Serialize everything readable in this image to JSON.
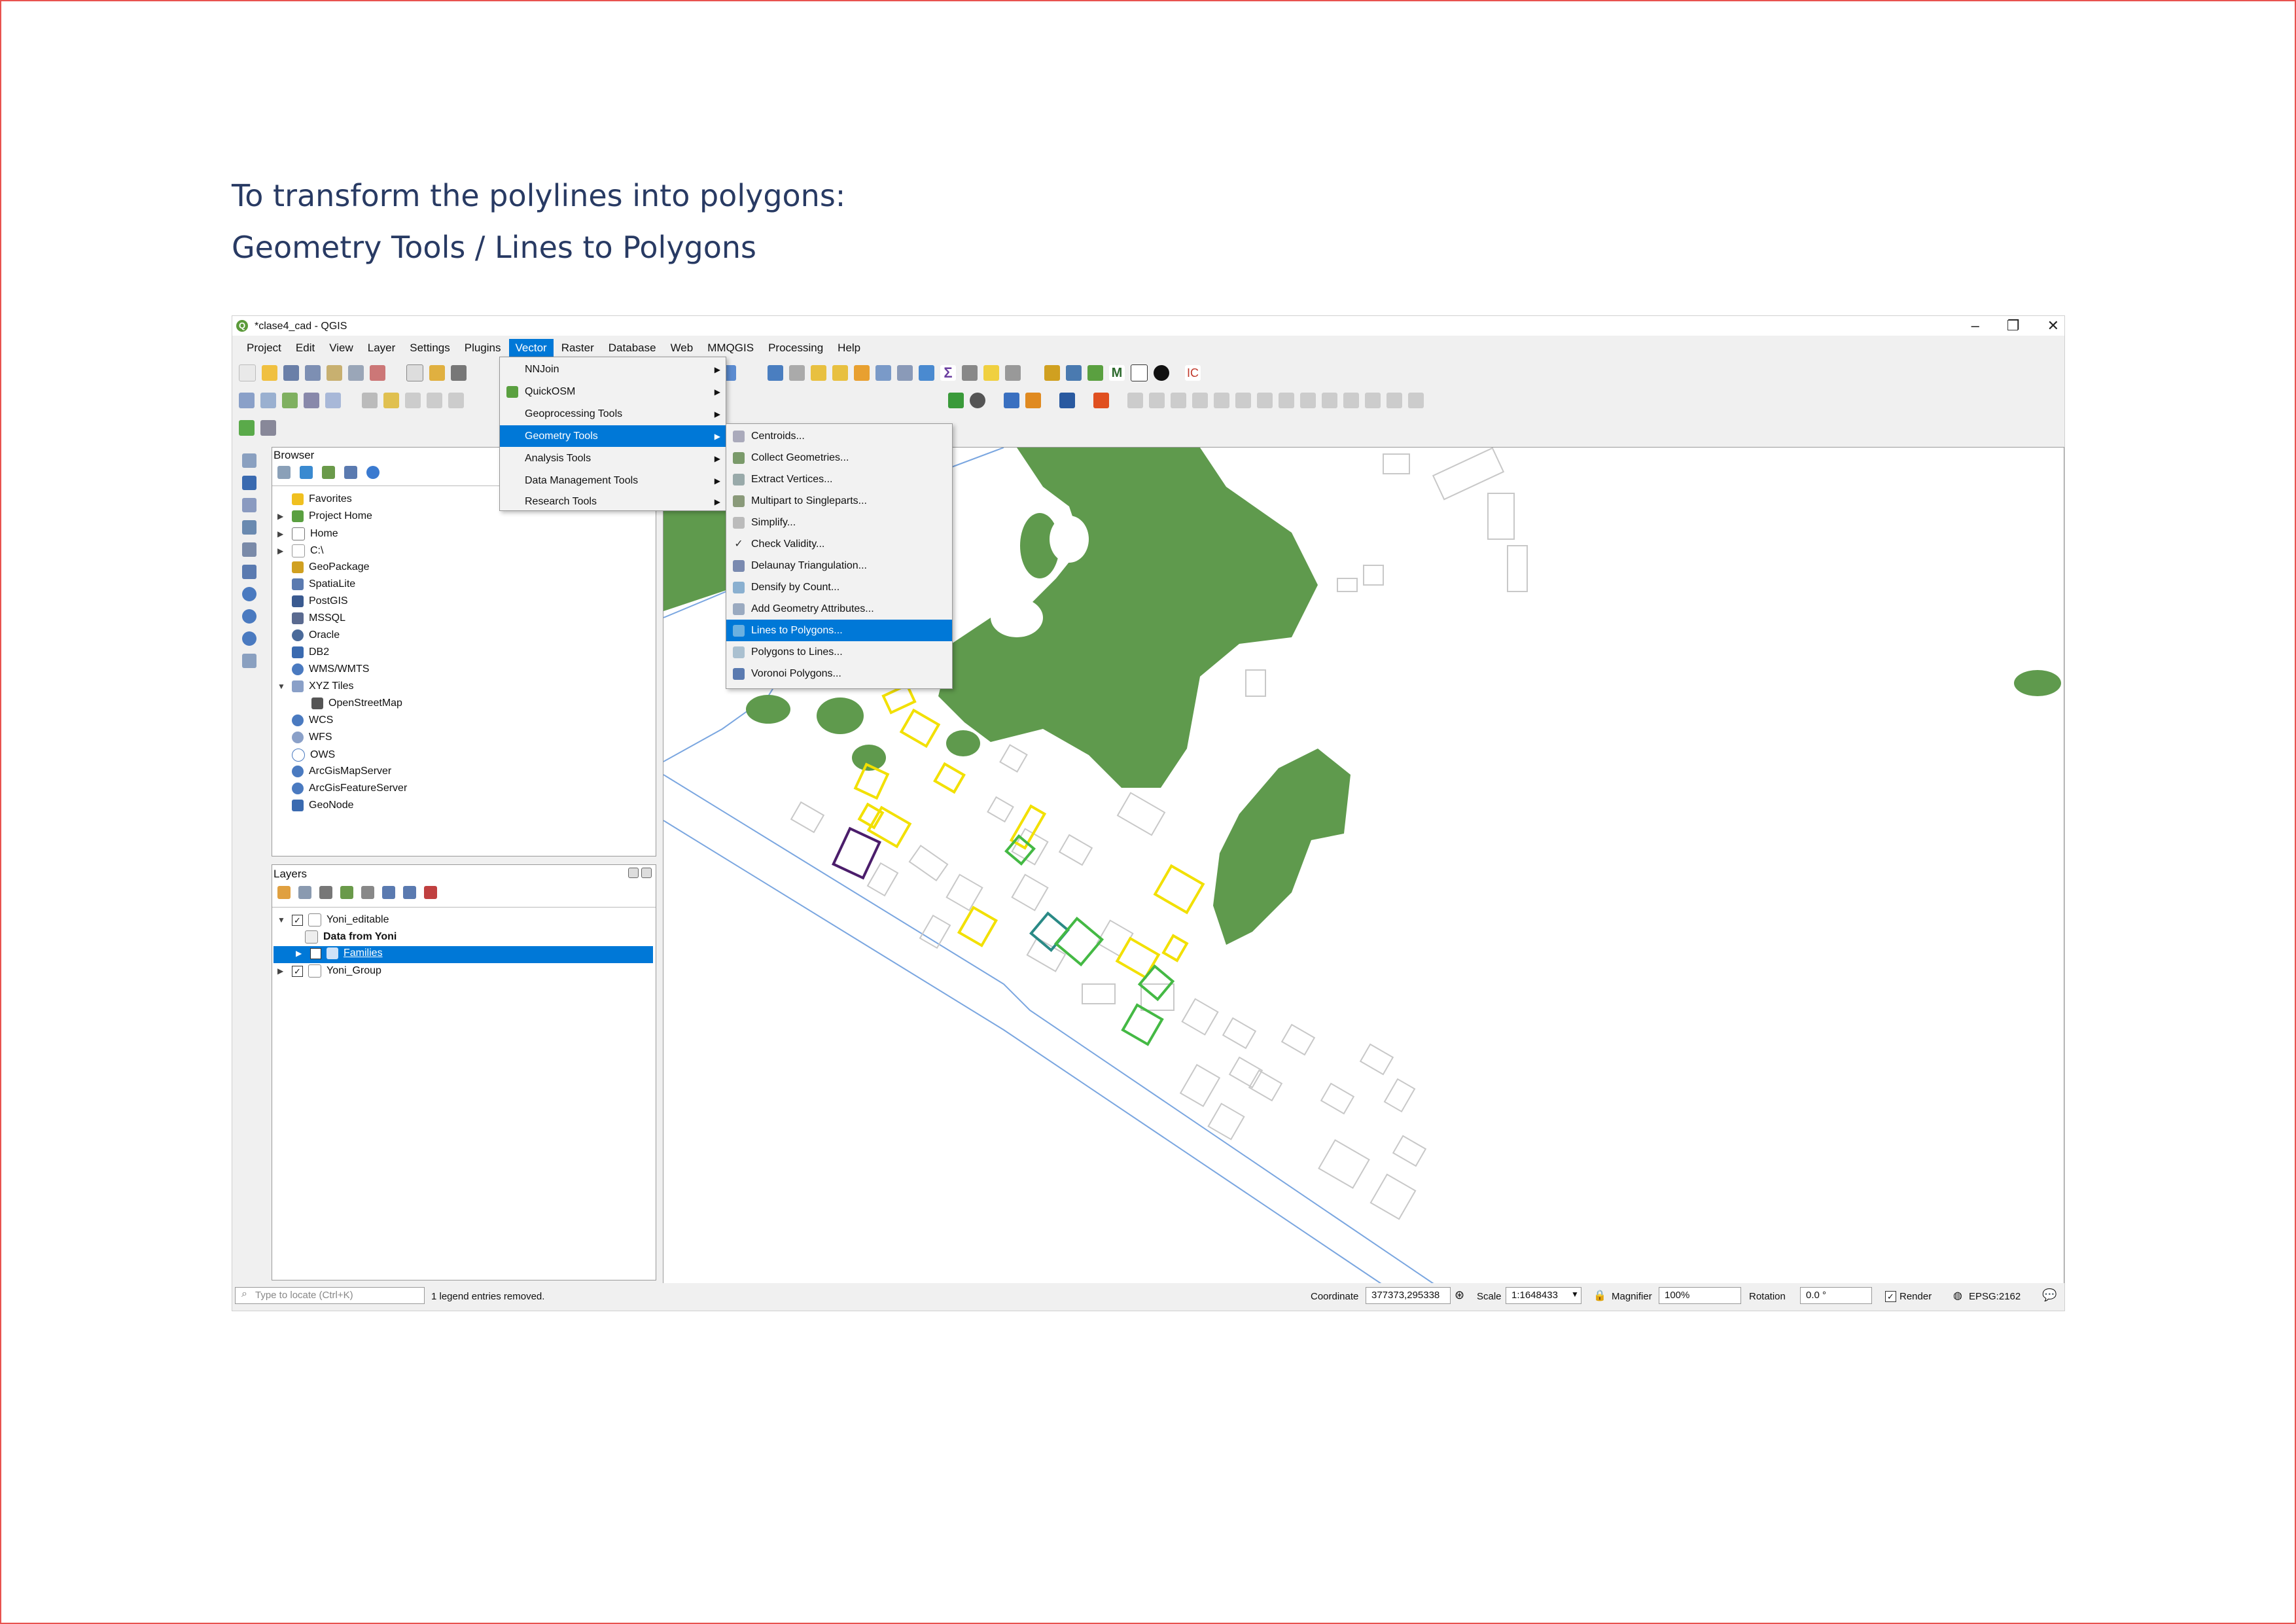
{
  "slide": {
    "line1": "To transform the polylines into polygons:",
    "line2": "Geometry Tools / Lines to Polygons"
  },
  "window": {
    "title": "*clase4_cad - QGIS",
    "minimize": "–",
    "restore": "❐",
    "close": "✕"
  },
  "menubar": [
    "Project",
    "Edit",
    "View",
    "Layer",
    "Settings",
    "Plugins",
    "Vector",
    "Raster",
    "Database",
    "Web",
    "MMQGIS",
    "Processing",
    "Help"
  ],
  "vector_menu": [
    "NNJoin",
    "QuickOSM",
    "Geoprocessing Tools",
    "Geometry Tools",
    "Analysis Tools",
    "Data Management Tools",
    "Research Tools"
  ],
  "geometry_menu": [
    "Centroids...",
    "Collect Geometries...",
    "Extract Vertices...",
    "Multipart to Singleparts...",
    "Simplify...",
    "Check Validity...",
    "Delaunay Triangulation...",
    "Densify by Count...",
    "Add Geometry Attributes...",
    "Lines to Polygons...",
    "Polygons to Lines...",
    "Voronoi Polygons..."
  ],
  "browser": {
    "title": "Browser",
    "items": [
      "Favorites",
      "Project Home",
      "Home",
      "C:\\",
      "GeoPackage",
      "SpatiaLite",
      "PostGIS",
      "MSSQL",
      "Oracle",
      "DB2",
      "WMS/WMTS",
      "XYZ Tiles",
      "OpenStreetMap",
      "WCS",
      "WFS",
      "OWS",
      "ArcGisMapServer",
      "ArcGisFeatureServer",
      "GeoNode"
    ]
  },
  "layers": {
    "title": "Layers",
    "items": [
      "Yoni_editable",
      "Data from Yoni",
      "Families",
      "Yoni_Group"
    ]
  },
  "status": {
    "locate_placeholder": "Type to locate (Ctrl+K)",
    "message": "1 legend entries removed.",
    "coordinate_label": "Coordinate",
    "coordinate_value": "377373,295338",
    "scale_label": "Scale",
    "scale_value": "1:1648433",
    "magnifier_label": "Magnifier",
    "magnifier_value": "100%",
    "rotation_label": "Rotation",
    "rotation_value": "0.0 °",
    "render_label": "Render",
    "crs": "EPSG:2162"
  },
  "colors": {
    "accent": "#0078d7",
    "vegetation": "#5f9a4d",
    "yellow": "#f2e000",
    "purple": "#4b1d6b",
    "teal": "#2a8a86",
    "green": "#44b944"
  }
}
